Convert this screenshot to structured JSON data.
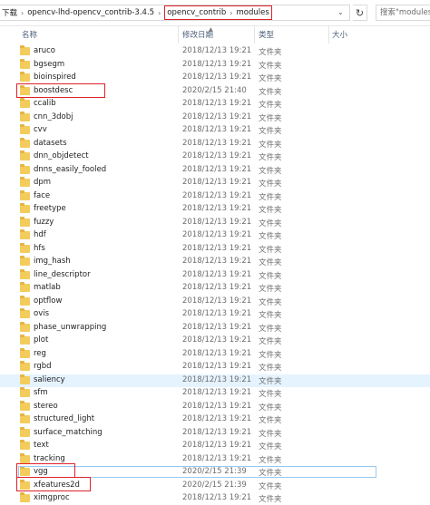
{
  "address_bar": {
    "crumbs": [
      "下载",
      "opencv-lhd-opencv_contrib-3.4.5",
      "opencv_contrib",
      "modules"
    ],
    "separator_icon": "chevron-right-icon",
    "refresh_icon": "refresh-icon",
    "search_placeholder": "搜索\"modules\""
  },
  "columns": {
    "name": "名称",
    "date": "修改日期",
    "type": "类型",
    "size": "大小"
  },
  "files": [
    {
      "name": "aruco",
      "date": "2018/12/13 19:21",
      "type": "文件夹"
    },
    {
      "name": "bgsegm",
      "date": "2018/12/13 19:21",
      "type": "文件夹"
    },
    {
      "name": "bioinspired",
      "date": "2018/12/13 19:21",
      "type": "文件夹"
    },
    {
      "name": "boostdesc",
      "date": "2020/2/15 21:40",
      "type": "文件夹"
    },
    {
      "name": "ccalib",
      "date": "2018/12/13 19:21",
      "type": "文件夹"
    },
    {
      "name": "cnn_3dobj",
      "date": "2018/12/13 19:21",
      "type": "文件夹"
    },
    {
      "name": "cvv",
      "date": "2018/12/13 19:21",
      "type": "文件夹"
    },
    {
      "name": "datasets",
      "date": "2018/12/13 19:21",
      "type": "文件夹"
    },
    {
      "name": "dnn_objdetect",
      "date": "2018/12/13 19:21",
      "type": "文件夹"
    },
    {
      "name": "dnns_easily_fooled",
      "date": "2018/12/13 19:21",
      "type": "文件夹"
    },
    {
      "name": "dpm",
      "date": "2018/12/13 19:21",
      "type": "文件夹"
    },
    {
      "name": "face",
      "date": "2018/12/13 19:21",
      "type": "文件夹"
    },
    {
      "name": "freetype",
      "date": "2018/12/13 19:21",
      "type": "文件夹"
    },
    {
      "name": "fuzzy",
      "date": "2018/12/13 19:21",
      "type": "文件夹"
    },
    {
      "name": "hdf",
      "date": "2018/12/13 19:21",
      "type": "文件夹"
    },
    {
      "name": "hfs",
      "date": "2018/12/13 19:21",
      "type": "文件夹"
    },
    {
      "name": "img_hash",
      "date": "2018/12/13 19:21",
      "type": "文件夹"
    },
    {
      "name": "line_descriptor",
      "date": "2018/12/13 19:21",
      "type": "文件夹"
    },
    {
      "name": "matlab",
      "date": "2018/12/13 19:21",
      "type": "文件夹"
    },
    {
      "name": "optflow",
      "date": "2018/12/13 19:21",
      "type": "文件夹"
    },
    {
      "name": "ovis",
      "date": "2018/12/13 19:21",
      "type": "文件夹"
    },
    {
      "name": "phase_unwrapping",
      "date": "2018/12/13 19:21",
      "type": "文件夹"
    },
    {
      "name": "plot",
      "date": "2018/12/13 19:21",
      "type": "文件夹"
    },
    {
      "name": "reg",
      "date": "2018/12/13 19:21",
      "type": "文件夹"
    },
    {
      "name": "rgbd",
      "date": "2018/12/13 19:21",
      "type": "文件夹"
    },
    {
      "name": "saliency",
      "date": "2018/12/13 19:21",
      "type": "文件夹",
      "state": "hover"
    },
    {
      "name": "sfm",
      "date": "2018/12/13 19:21",
      "type": "文件夹"
    },
    {
      "name": "stereo",
      "date": "2018/12/13 19:21",
      "type": "文件夹"
    },
    {
      "name": "structured_light",
      "date": "2018/12/13 19:21",
      "type": "文件夹"
    },
    {
      "name": "surface_matching",
      "date": "2018/12/13 19:21",
      "type": "文件夹"
    },
    {
      "name": "text",
      "date": "2018/12/13 19:21",
      "type": "文件夹"
    },
    {
      "name": "tracking",
      "date": "2018/12/13 19:21",
      "type": "文件夹"
    },
    {
      "name": "vgg",
      "date": "2020/2/15 21:39",
      "type": "文件夹",
      "state": "focused"
    },
    {
      "name": "xfeatures2d",
      "date": "2020/2/15 21:39",
      "type": "文件夹"
    },
    {
      "name": "ximgproc",
      "date": "2018/12/13 19:21",
      "type": "文件夹"
    }
  ],
  "colors": {
    "highlight_box": "#e0212a",
    "folder": "#f3cc5c",
    "selection": "#e5f3ff",
    "header_text": "#4c607a"
  }
}
